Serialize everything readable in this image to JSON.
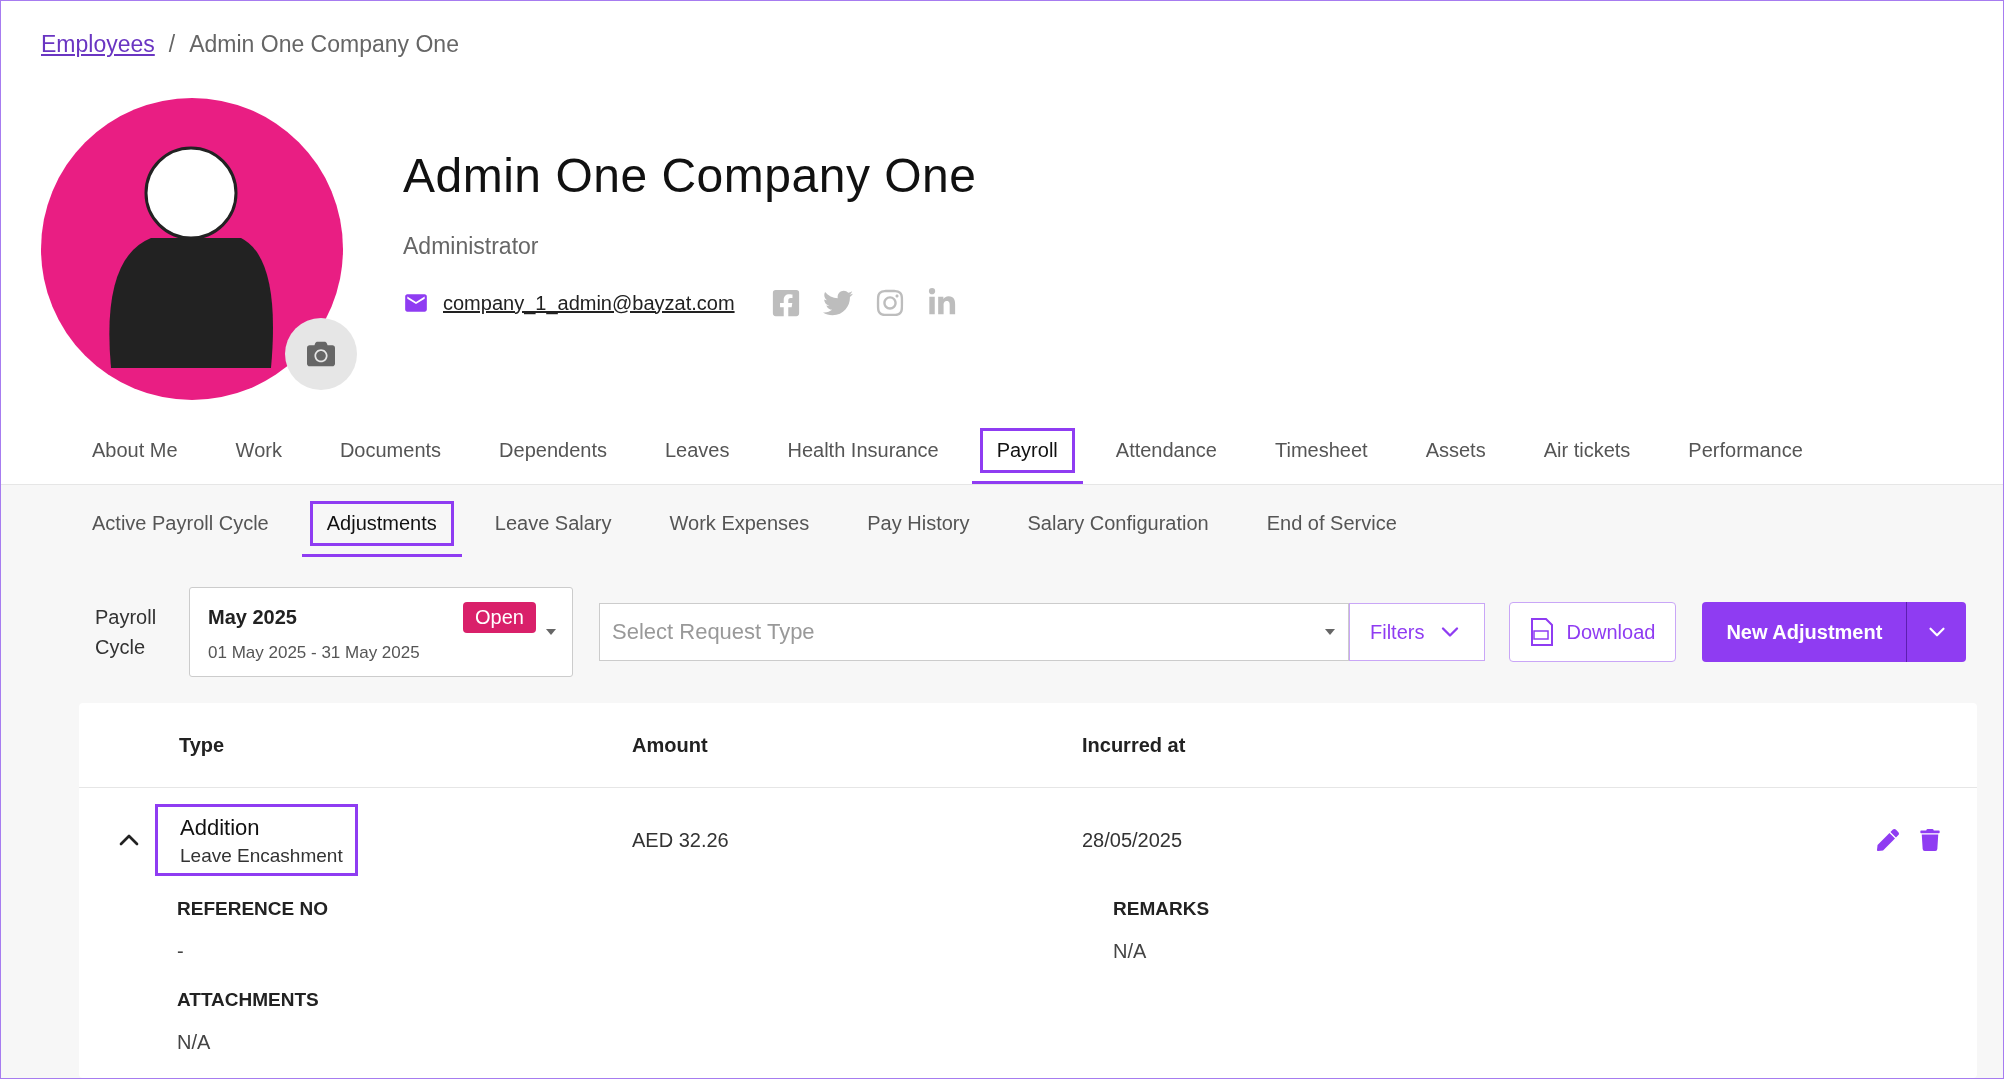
{
  "breadcrumb": {
    "link": "Employees",
    "separator": "/",
    "current": "Admin One Company One"
  },
  "profile": {
    "name": "Admin One Company One",
    "role": "Administrator",
    "email": "company_1_admin@bayzat.com"
  },
  "tabs": [
    {
      "label": "About Me",
      "selected": false,
      "highlighted": false
    },
    {
      "label": "Work",
      "selected": false,
      "highlighted": false
    },
    {
      "label": "Documents",
      "selected": false,
      "highlighted": false
    },
    {
      "label": "Dependents",
      "selected": false,
      "highlighted": false
    },
    {
      "label": "Leaves",
      "selected": false,
      "highlighted": false
    },
    {
      "label": "Health Insurance",
      "selected": false,
      "highlighted": false
    },
    {
      "label": "Payroll",
      "selected": true,
      "highlighted": true
    },
    {
      "label": "Attendance",
      "selected": false,
      "highlighted": false
    },
    {
      "label": "Timesheet",
      "selected": false,
      "highlighted": false
    },
    {
      "label": "Assets",
      "selected": false,
      "highlighted": false
    },
    {
      "label": "Air tickets",
      "selected": false,
      "highlighted": false
    },
    {
      "label": "Performance",
      "selected": false,
      "highlighted": false
    }
  ],
  "subtabs": [
    {
      "label": "Active Payroll Cycle",
      "selected": false,
      "highlighted": false
    },
    {
      "label": "Adjustments",
      "selected": true,
      "highlighted": true
    },
    {
      "label": "Leave Salary",
      "selected": false,
      "highlighted": false
    },
    {
      "label": "Work Expenses",
      "selected": false,
      "highlighted": false
    },
    {
      "label": "Pay History",
      "selected": false,
      "highlighted": false
    },
    {
      "label": "Salary Configuration",
      "selected": false,
      "highlighted": false
    },
    {
      "label": "End of Service",
      "selected": false,
      "highlighted": false
    }
  ],
  "payroll_cycle": {
    "label": "Payroll Cycle",
    "month": "May 2025",
    "status": "Open",
    "range": "01 May 2025 - 31 May 2025"
  },
  "request_type": {
    "placeholder": "Select Request Type"
  },
  "buttons": {
    "filters": "Filters",
    "download": "Download",
    "new_adjustment": "New Adjustment"
  },
  "table": {
    "columns": [
      "Type",
      "Amount",
      "Incurred at"
    ],
    "rows": [
      {
        "type": "Addition",
        "subtype": "Leave Encashment",
        "highlighted": true,
        "amount": "AED 32.26",
        "incurred_at": "28/05/2025",
        "expanded": true,
        "details": [
          {
            "label": "REFERENCE NO",
            "value": "-"
          },
          {
            "label": "REMARKS",
            "value": "N/A"
          },
          {
            "label": "ATTACHMENTS",
            "value": "N/A"
          }
        ]
      }
    ]
  }
}
